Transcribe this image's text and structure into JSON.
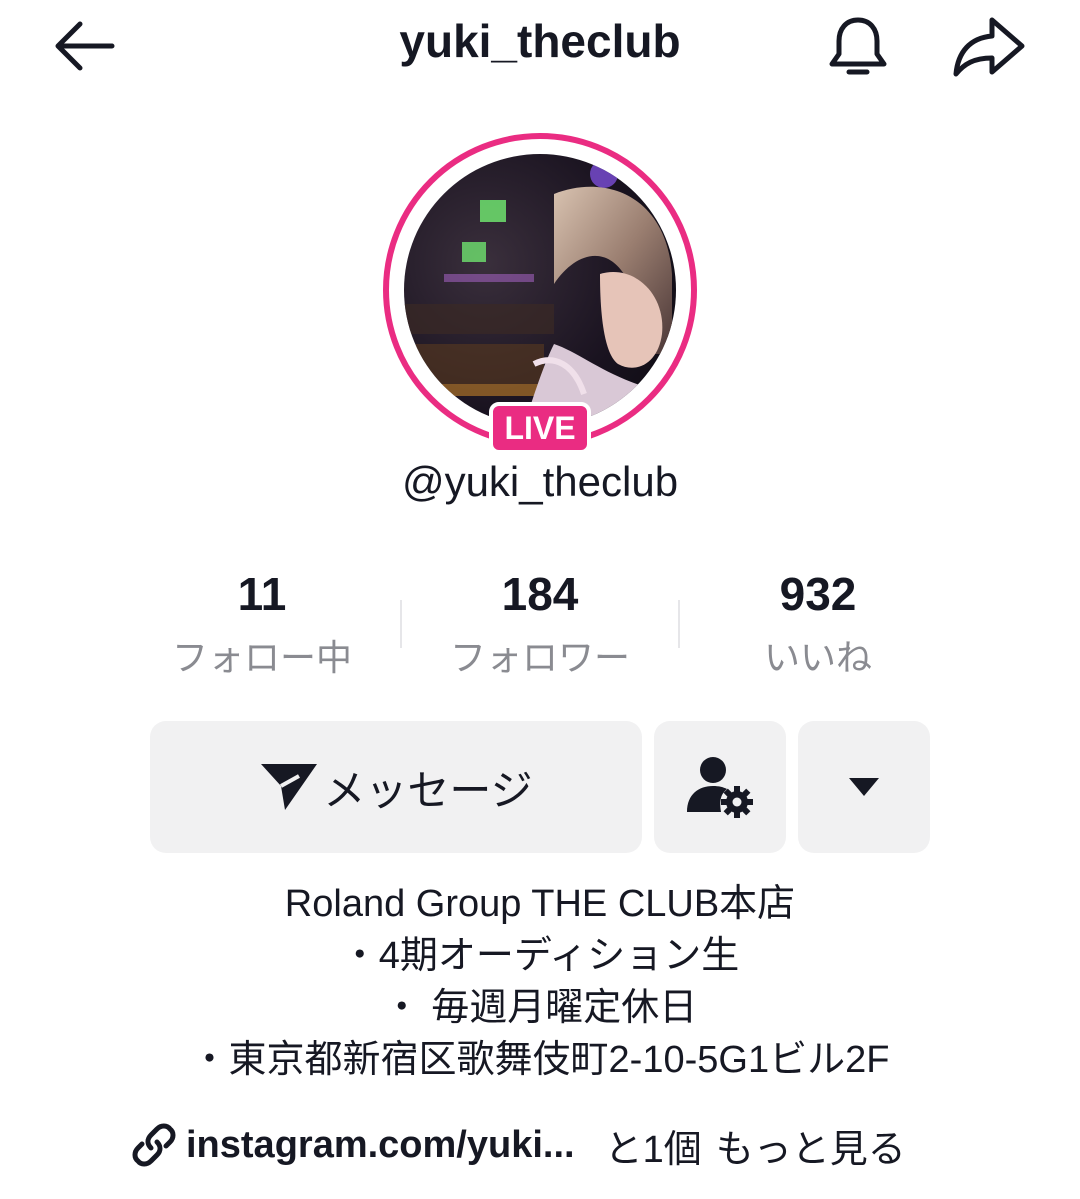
{
  "topbar": {
    "title": "yuki_theclub",
    "back_icon": "arrow-left-icon",
    "bell_icon": "bell-icon",
    "share_icon": "share-arrow-icon"
  },
  "profile": {
    "live_label": "LIVE",
    "handle": "@yuki_theclub",
    "ring_color": "#ea2c82"
  },
  "stats": [
    {
      "value": "11",
      "label": "フォロー中"
    },
    {
      "value": "184",
      "label": "フォロワー"
    },
    {
      "value": "932",
      "label": "いいね"
    }
  ],
  "actions": {
    "message_label": "メッセージ",
    "message_icon": "send-icon",
    "friend_settings_icon": "user-gear-icon",
    "more_icon": "caret-down-icon"
  },
  "bio": {
    "lines": [
      "Roland Group THE CLUB本店",
      "・4期オーディション生",
      "・ 毎週月曜定休日",
      "・東京都新宿区歌舞伎町2-10-5G1ビル2F"
    ]
  },
  "link": {
    "icon": "link-icon",
    "text": "instagram.com/yuki...",
    "extra": "と1個",
    "more_label": "もっと見る"
  }
}
